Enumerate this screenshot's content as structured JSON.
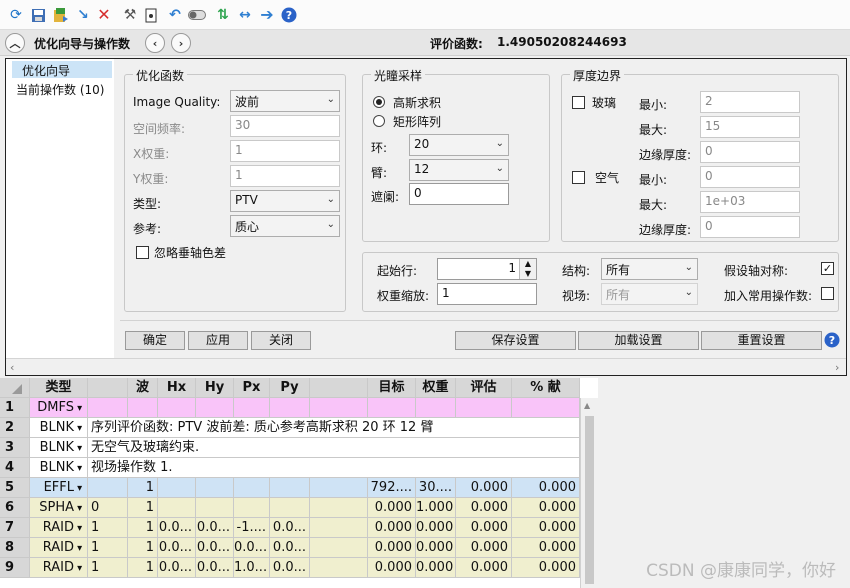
{
  "toolbar": {
    "icons": [
      "refresh-icon",
      "save-icon",
      "save-as-icon",
      "arrow-down-icon",
      "delete-icon",
      "tools-icon",
      "device-icon",
      "undo-icon",
      "toggle-icon",
      "sync-icon",
      "expand-icon",
      "next-icon",
      "help-icon"
    ]
  },
  "header": {
    "title": "优化向导与操作数",
    "merit_label": "评价函数:",
    "merit_value": "1.49050208244693"
  },
  "nav": {
    "items": [
      "优化向导",
      "当前操作数 (10)"
    ]
  },
  "merit_group": {
    "title": "优化函数",
    "image_quality_label": "Image Quality:",
    "image_quality_value": "波前",
    "spatial_freq_label": "空间频率:",
    "spatial_freq_value": "30",
    "x_weight_label": "X权重:",
    "x_weight_value": "1",
    "y_weight_label": "Y权重:",
    "y_weight_value": "1",
    "type_label": "类型:",
    "type_value": "PTV",
    "reference_label": "参考:",
    "reference_value": "质心",
    "ignore_lateral_label": "忽略垂轴色差"
  },
  "pupil_group": {
    "title": "光瞳采样",
    "gaussian_label": "高斯求积",
    "rect_label": "矩形阵列",
    "rings_label": "环:",
    "rings_value": "20",
    "arms_label": "臂:",
    "arms_value": "12",
    "obscuration_label": "遮阑:",
    "obscuration_value": "0"
  },
  "thickness_group": {
    "title": "厚度边界",
    "glass_label": "玻璃",
    "air_label": "空气",
    "min_label": "最小:",
    "max_label": "最大:",
    "edge_label": "边缘厚度:",
    "glass_min": "2",
    "glass_max": "15",
    "glass_edge": "0",
    "air_min": "0",
    "air_max": "1e+03",
    "air_edge": "0"
  },
  "extra_group": {
    "start_row_label": "起始行:",
    "start_row_value": "1",
    "weight_scale_label": "权重缩放:",
    "weight_scale_value": "1",
    "config_label": "结构:",
    "config_value": "所有",
    "field_label": "视场:",
    "field_value": "所有",
    "assume_symmetry_label": "假设轴对称:",
    "assume_symmetry_checked": true,
    "add_common_label": "加入常用操作数:",
    "add_common_checked": false
  },
  "buttons": {
    "ok": "确定",
    "apply": "应用",
    "close": "关闭",
    "save_settings": "保存设置",
    "load_settings": "加载设置",
    "reset_settings": "重置设置"
  },
  "grid": {
    "headers": [
      "",
      "类型",
      "",
      "波",
      "Hx",
      "Hy",
      "Px",
      "Py",
      "",
      "目标",
      "权重",
      "评估",
      "% 献"
    ],
    "rows": [
      [
        "1",
        "DMFS",
        "",
        "",
        "",
        "",
        "",
        "",
        "",
        "",
        "",
        "",
        ""
      ],
      [
        "2",
        "BLNK",
        "序列评价函数: PTV 波前差: 质心参考高斯求积 20 环 12 臂"
      ],
      [
        "3",
        "BLNK",
        "无空气及玻璃约束."
      ],
      [
        "4",
        "BLNK",
        "视场操作数 1."
      ],
      [
        "5",
        "EFFL",
        "",
        "1",
        "",
        "",
        "",
        "",
        "",
        "792....",
        "30....",
        "0.000",
        "0.000"
      ],
      [
        "6",
        "SPHA",
        "0",
        "1",
        "",
        "",
        "",
        "",
        "",
        "0.000",
        "1.000",
        "0.000",
        "0.000"
      ],
      [
        "7",
        "RAID",
        "1",
        "1",
        "0.0...",
        "0.0...",
        "-1....",
        "0.0...",
        "",
        "0.000",
        "0.000",
        "0.000",
        "0.000"
      ],
      [
        "8",
        "RAID",
        "1",
        "1",
        "0.0...",
        "0.0...",
        "0.0...",
        "0.0...",
        "",
        "0.000",
        "0.000",
        "0.000",
        "0.000"
      ],
      [
        "9",
        "RAID",
        "1",
        "1",
        "0.0...",
        "0.0...",
        "1.0...",
        "0.0...",
        "",
        "0.000",
        "0.000",
        "0.000",
        "0.000"
      ]
    ]
  },
  "watermark": "CSDN @康康同学，你好",
  "colors": {
    "dmfs_row": "#f9c4f9",
    "blnk_row": "#ffffff",
    "effl_row": "#cfe3f5",
    "raid_row": "#f0efcf",
    "header": "#d7d7d7",
    "nav_selected": "#cce4f7"
  }
}
